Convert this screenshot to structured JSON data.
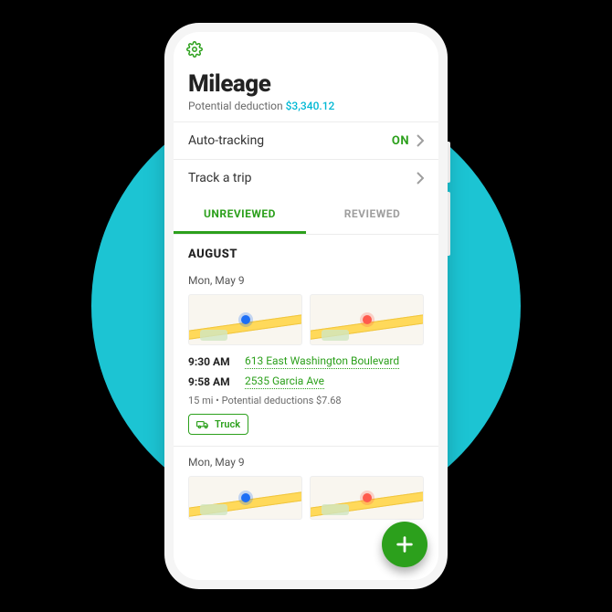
{
  "header": {
    "title": "Mileage",
    "subtitle_label": "Potential deduction ",
    "subtitle_value": "$3,340.12"
  },
  "rows": {
    "auto_tracking": {
      "label": "Auto-tracking",
      "status": "ON"
    },
    "track_trip": {
      "label": "Track a trip"
    }
  },
  "tabs": {
    "unreviewed": "UNREVIEWED",
    "reviewed": "REVIEWED"
  },
  "month": "AUGUST",
  "trips": [
    {
      "date": "Mon, May 9",
      "start_time": "9:30 AM",
      "start_addr": "613 East Washington Boulevard",
      "end_time": "9:58 AM",
      "end_addr": "2535 Garcia Ave",
      "meta": "15 mi • Potential deductions $7.68",
      "vehicle": "Truck"
    },
    {
      "date": "Mon, May 9"
    }
  ]
}
